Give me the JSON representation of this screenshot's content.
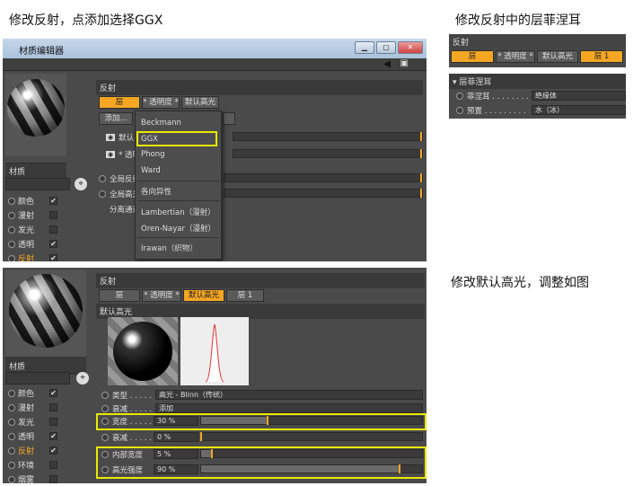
{
  "captions": {
    "top_left": "修改反射，点添加选择GGX",
    "top_right": "修改反射中的层菲涅耳",
    "bottom_right": "修改默认高光，调整如图"
  },
  "window": {
    "title": "材质编辑器"
  },
  "left_panel": {
    "material_label": "材质",
    "channels": [
      {
        "label": "颜色",
        "checked": "✔"
      },
      {
        "label": "漫射",
        "checked": ""
      },
      {
        "label": "发光",
        "checked": ""
      },
      {
        "label": "透明",
        "checked": "✔"
      },
      {
        "label": "反射",
        "checked": "✔"
      },
      {
        "label": "环境",
        "checked": ""
      },
      {
        "label": "烟雾",
        "checked": ""
      }
    ]
  },
  "top_panel": {
    "section": "反射",
    "tabs": [
      "层",
      "* 透明度 *",
      "默认高光"
    ],
    "add_button": "添加...",
    "row_default": "默认",
    "row_transparency": "* 透明",
    "row_global_reflection": "全局反射",
    "row_global_specular": "全局高光",
    "row_separate": "分离通道",
    "menu": [
      "Beckmann",
      "GGX",
      "Phong",
      "Ward",
      "各向异性",
      "Lambertian（漫射）",
      "Oren-Nayar（漫射）",
      "Irawan（织物）"
    ]
  },
  "tr_panel": {
    "section": "反射",
    "tabs": [
      "层",
      "* 透明度 *",
      "默认高光",
      "层 1"
    ],
    "fresnel_header": "▾ 层菲涅耳",
    "fresnel_label": "菲涅耳 . . . . . . . .",
    "fresnel_value": "绝缘体",
    "preset_label": "预置 . . . . . . . . .",
    "preset_value": "水（冰）"
  },
  "bottom_panel": {
    "section": "反射",
    "tabs": [
      "层",
      "* 透明度 *",
      "默认高光",
      "层 1"
    ],
    "subsection": "默认高光",
    "type_label": "类型 . . . . .",
    "type_value": "高光 - Blinn（传统）",
    "atten_label": "衰减 . . . . .",
    "atten_value": "添加",
    "params": [
      {
        "label": "宽度 . . . . .",
        "value": "30 %",
        "pct": 30
      },
      {
        "label": "衰减 . . . . .",
        "value": "0 %",
        "pct": 0
      },
      {
        "label": "内部宽度",
        "value": "5 %",
        "pct": 5
      },
      {
        "label": "高光强度",
        "value": "90 %",
        "pct": 90
      }
    ]
  }
}
